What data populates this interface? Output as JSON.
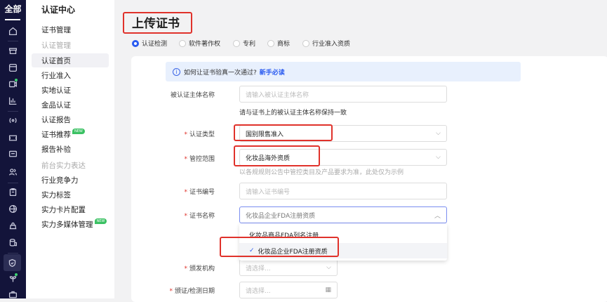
{
  "rail": {
    "all_label": "全部",
    "icons": [
      "home-icon",
      "store-icon",
      "window-icon",
      "video-icon",
      "chart-icon",
      "broadcast-icon",
      "ticket-icon",
      "message-icon",
      "users-icon",
      "clipboard-icon",
      "globe-icon",
      "bag-icon",
      "coins-icon",
      "shield-check-icon",
      "sprout-icon",
      "briefcase-icon"
    ]
  },
  "nav": {
    "title": "认证中心",
    "items": [
      {
        "label": "证书管理",
        "type": "item"
      },
      {
        "label": "认证管理",
        "type": "group"
      },
      {
        "label": "认证首页",
        "type": "active"
      },
      {
        "label": "行业准入",
        "type": "item"
      },
      {
        "label": "实地认证",
        "type": "item"
      },
      {
        "label": "金品认证",
        "type": "item"
      },
      {
        "label": "认证报告",
        "type": "item"
      },
      {
        "label": "证书推荐",
        "type": "item",
        "badge": "NEW"
      },
      {
        "label": "报告补验",
        "type": "item"
      },
      {
        "label": "前台实力表达",
        "type": "group"
      },
      {
        "label": "行业竞争力",
        "type": "item"
      },
      {
        "label": "实力标签",
        "type": "item"
      },
      {
        "label": "实力卡片配置",
        "type": "item"
      },
      {
        "label": "实力多媒体管理",
        "type": "item",
        "badge": "NEW"
      }
    ]
  },
  "page": {
    "title": "上传证书",
    "tabs": [
      {
        "label": "认证检测",
        "checked": true
      },
      {
        "label": "软件著作权"
      },
      {
        "label": "专利"
      },
      {
        "label": "商标"
      },
      {
        "label": "行业准入资质"
      }
    ],
    "banner": {
      "text": "如何让证书验真一次通过?",
      "link": "新手必读"
    },
    "form": {
      "subject": {
        "label": "被认证主体名称",
        "placeholder": "请输入被认证主体名称",
        "hint": "请与证书上的被认证主体名称保持一致"
      },
      "type": {
        "label": "认证类型",
        "value": "国别限售准入"
      },
      "scope": {
        "label": "管控范围",
        "value": "化妆品海外资质",
        "hint": "以各规规则公告中管控类目及产品要求为准，此处仅为示例"
      },
      "cert_no": {
        "label": "证书编号",
        "placeholder": "请输入证书编号"
      },
      "cert_name": {
        "label": "证书名称",
        "value": "化妆品企业FDA注册资质",
        "options": [
          "化妆品商品FDA列名注册",
          "化妆品企业FDA注册资质"
        ],
        "check": "✓"
      },
      "issuer": {
        "label": "颁发机构",
        "placeholder": "请选择..."
      },
      "date": {
        "label": "颁证/检测日期",
        "placeholder": "请选择..."
      }
    }
  }
}
